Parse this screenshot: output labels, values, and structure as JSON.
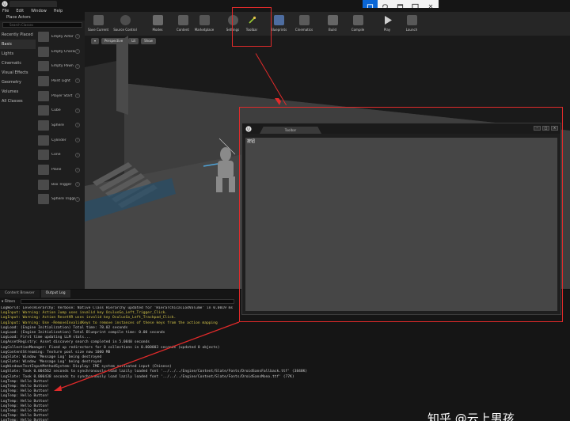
{
  "menu": [
    "File",
    "Edit",
    "Window",
    "Help"
  ],
  "left_panel": {
    "header": "Place Actors",
    "search_placeholder": "Search Classes",
    "categories": [
      "Recently Placed",
      "Basic",
      "Lights",
      "Cinematic",
      "Visual Effects",
      "Geometry",
      "Volumes",
      "All Classes"
    ],
    "selected_category": "Basic",
    "items": [
      "Empty Actor",
      "Empty Character",
      "Empty Pawn",
      "Point Light",
      "Player Start",
      "Cube",
      "Sphere",
      "Cylinder",
      "Cone",
      "Plane",
      "Box Trigger",
      "Sphere Trigger"
    ]
  },
  "toolbar": {
    "buttons": [
      "Save Current",
      "Source Control",
      "Modes",
      "Content",
      "Marketplace",
      "Settings",
      "Toolbar",
      "Blueprints",
      "Cinematics",
      "Build",
      "Compile",
      "Play",
      "Launch"
    ]
  },
  "viewport": {
    "buttons": [
      "Perspective",
      "Lit",
      "Show"
    ]
  },
  "bottom": {
    "tabs": [
      "Content Browser",
      "Output Log"
    ],
    "active_tab": "Output Log",
    "filters_label": "Filters",
    "log": [
      {
        "t": "LogWorld: LevelHierarchy: Verbose: Native Class Hierarchy updated for 'HierarchicalLodVolume' in 0.0019 ms",
        "k": "norm"
      },
      {
        "t": "LogInput: Warning: Action Jump uses invalid key OculusGo_Left_Trigger_Click.",
        "k": "warn"
      },
      {
        "t": "LogInput: Warning: Action ResetVR uses invalid key OculusGo_Left_Trackpad_Click.",
        "k": "warn"
      },
      {
        "t": "LogInput: Warning: Use -RemoveInvalidKeys to remove instances of these keys from the action mapping",
        "k": "warn"
      },
      {
        "t": "LogLoad: (Engine Initialization) Total time: 78.02 seconds",
        "k": "norm"
      },
      {
        "t": "LogLoad: (Engine Initialization) Total Blueprint compile time: 0.00 seconds",
        "k": "norm"
      },
      {
        "t": "LogLoad: First time updating LLM stats...",
        "k": "norm"
      },
      {
        "t": "LogAssetRegistry: Asset discovery search completed in 5.0840 seconds",
        "k": "norm"
      },
      {
        "t": "LogCollectionManager: Fixed up redirectors for 0 collections in 0.000003 seconds (updated 0 objects)",
        "k": "norm"
      },
      {
        "t": "LogContentStreaming: Texture pool size now 1000 MB",
        "k": "norm"
      },
      {
        "t": "LogSlate: Window 'Message Log' being destroyed",
        "k": "norm"
      },
      {
        "t": "LogSlate: Window 'Message Log' being destroyed",
        "k": "norm"
      },
      {
        "t": "LogWindowsTextInputMethodSystem: Display: IME system activated input (Chinese)",
        "k": "norm"
      },
      {
        "t": "LogSlate: Took 0.004562 seconds to synchronously load lazily loaded font '../../../Engine/Content/Slate/Fonts/DroidSansFallback.ttf' (3848K)",
        "k": "norm"
      },
      {
        "t": "LogSlate: Took 0.000438 seconds to synchronously load lazily loaded font '../../../Engine/Content/Slate/Fonts/DroidSansMono.ttf' (77K)",
        "k": "norm"
      },
      {
        "t": "LogTemp: Hello Button!",
        "k": "norm"
      },
      {
        "t": "LogTemp: Hello Button!",
        "k": "norm"
      },
      {
        "t": "LogTemp: Hello Button!",
        "k": "norm"
      },
      {
        "t": "LogTemp: Hello Button!",
        "k": "norm"
      },
      {
        "t": "LogTemp: Hello Button!",
        "k": "norm"
      },
      {
        "t": "LogTemp: Hello Button!",
        "k": "norm"
      },
      {
        "t": "LogTemp: Hello Button!",
        "k": "norm"
      },
      {
        "t": "LogTemp: Hello Button!",
        "k": "norm"
      },
      {
        "t": "LogTemp: Hello Button!",
        "k": "norm"
      },
      {
        "t": "LogTemp: Hello Button!",
        "k": "norm"
      }
    ]
  },
  "popup": {
    "tab_label": "Toolbar",
    "body_label": "按钮",
    "controls": [
      "–",
      "□",
      "✕"
    ]
  },
  "watermark": "知乎 @云上男孩",
  "colors": {
    "annotation": "#e02a2a",
    "snip_active": "#0a66d6",
    "warning_text": "#d3c44a"
  }
}
